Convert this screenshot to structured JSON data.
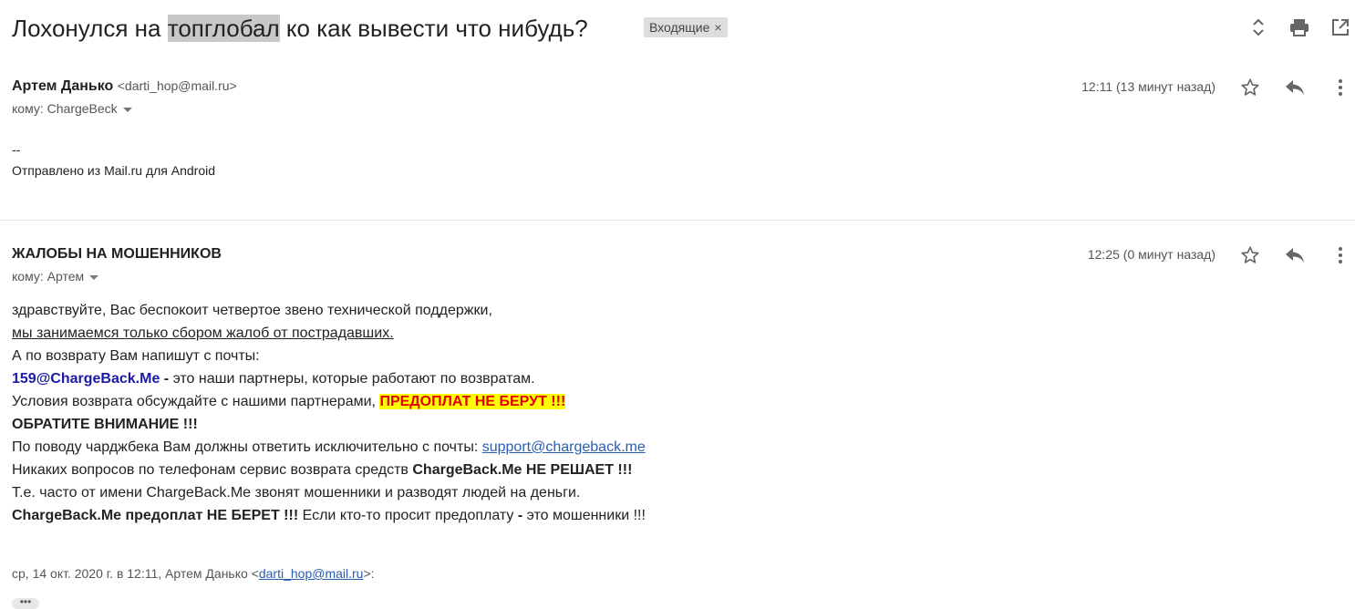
{
  "subject": {
    "before": "Лохонулся на ",
    "highlight": "топглобал",
    "after": " ко как вывести что нибудь?",
    "label": "Входящие",
    "label_close": "×"
  },
  "toolbar": {
    "icons": [
      "expand-collapse-icon",
      "print-icon",
      "open-in-new-window-icon"
    ]
  },
  "messages": [
    {
      "sender_name": "Артем Данько",
      "sender_email": "<darti_hop@mail.ru>",
      "to": "кому: ChargeBeck",
      "time": "12:11 (13 минут назад)",
      "body": [
        "--",
        "Отправлено из Mail.ru для Android"
      ]
    },
    {
      "sender_name": "ЖАЛОБЫ НА МОШЕННИКОВ",
      "to": "кому: Артем",
      "time": "12:25 (0 минут назад)",
      "body": {
        "l1": "здравствуйте, Вас беспокоит четвертое звено технической поддержки,",
        "l2": "мы занимаемся только сбором жалоб от пострадавших.",
        "l3": "А по возврату Вам напишут с почты:",
        "l4_email": "159@ChargeBack.Me",
        "l4_dash": " - ",
        "l4_rest": "это наши партнеры, которые работают по возвратам.",
        "l5_text": "Условия возврата обсуждайте с нашими партнерами, ",
        "l5_warn": "ПРЕДОПЛАТ НЕ БЕРУТ !!!",
        "l6": "ОБРАТИТЕ ВНИМАНИЕ !!!",
        "l7_text": "По поводу чарджбека Вам должны ответить исключительно с почты: ",
        "l7_link": "support@chargeback.me",
        "l8_text": "Никаких вопросов по телефонам сервис возврата средств ",
        "l8_bold": "ChargeBack.Me НЕ РЕШАЕТ !!!",
        "l9": "Т.е. часто от имени ChargeBack.Me звонят мошенники и разводят людей на деньги.",
        "l10_bold": "ChargeBack.Me предоплат НЕ БЕРЕТ !!!",
        "l10_text": " Если кто-то просит предоплату ",
        "l10_dash": "-",
        "l10_end": " это мошенники !!!"
      },
      "quote": {
        "prefix": "ср, 14 окт. 2020 г. в 12:11, Артем Данько <",
        "email": "darti_hop@mail.ru",
        "suffix": ">:"
      },
      "more": "•••"
    }
  ]
}
